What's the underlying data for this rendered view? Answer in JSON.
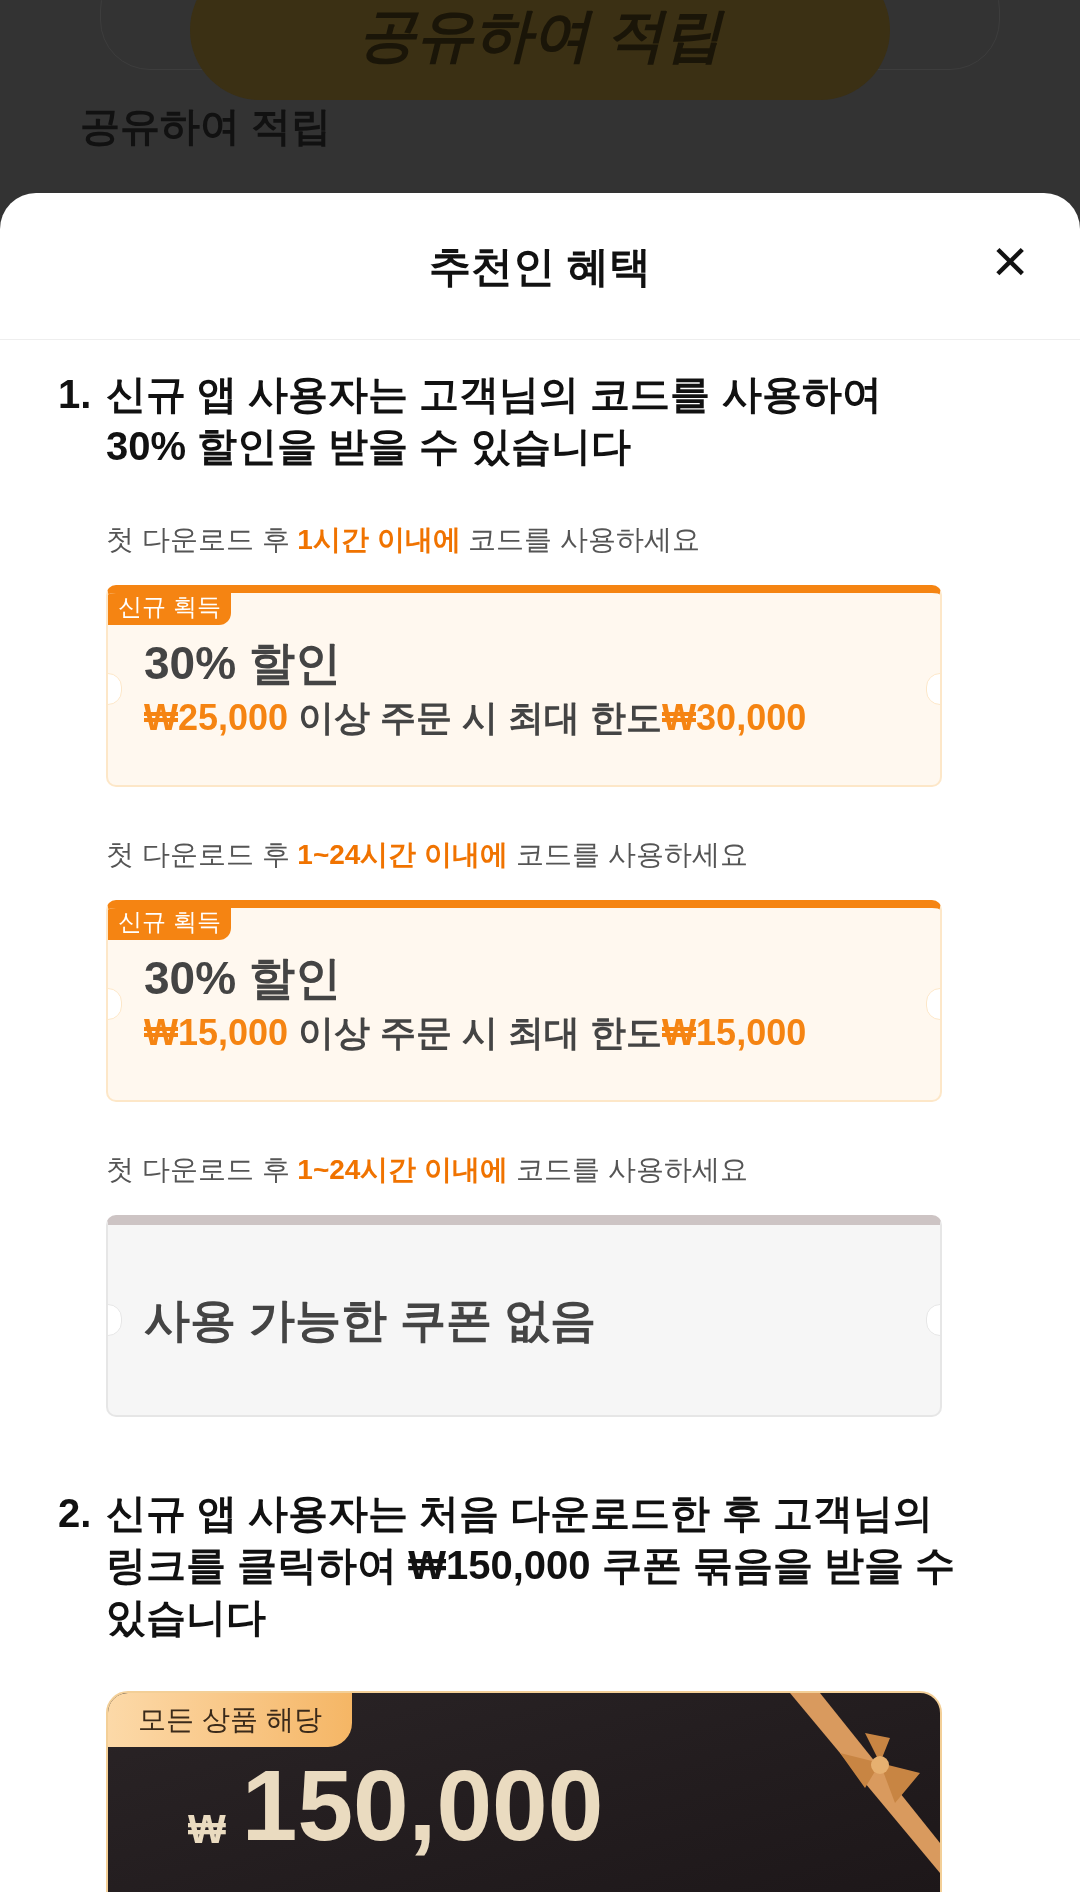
{
  "background": {
    "button": "공유하여 적립",
    "heading": "공유하여 적립"
  },
  "sheet": {
    "title": "추천인 혜택",
    "close": "×"
  },
  "sections": [
    {
      "number": "1.",
      "title": "신규 앱 사용자는 고객님의 코드를 사용하여 30% 할인을 받을 수 있습니다",
      "coupons": [
        {
          "kind": "discount",
          "note": "첫 다운로드 후 **1시간 이내에** 코드를 사용하세요",
          "badge": "신규 획득",
          "headline": "30% 할인",
          "min": "₩25,000",
          "middle": " 이상 주문 시 최대 한도",
          "max": "₩30,000"
        },
        {
          "kind": "discount",
          "note": "첫 다운로드 후 **1~24시간 이내에** 코드를 사용하세요",
          "badge": "신규 획득",
          "headline": "30% 할인",
          "min": "₩15,000",
          "middle": " 이상 주문 시 최대 한도",
          "max": "₩15,000"
        },
        {
          "kind": "empty",
          "note": "첫 다운로드 후 **1~24시간 이내에** 코드를 사용하세요",
          "headline": "사용 가능한 쿠폰 없음"
        }
      ]
    },
    {
      "number": "2.",
      "title": "신규 앱 사용자는 처음 다운로드한 후 고객님의 링크를 클릭하여 ₩150,000 쿠폰 묶음을 받을 수 있습니다",
      "banner": {
        "badge": "모든 상품 해당",
        "currency": "₩",
        "amount": "150,000"
      }
    }
  ]
}
